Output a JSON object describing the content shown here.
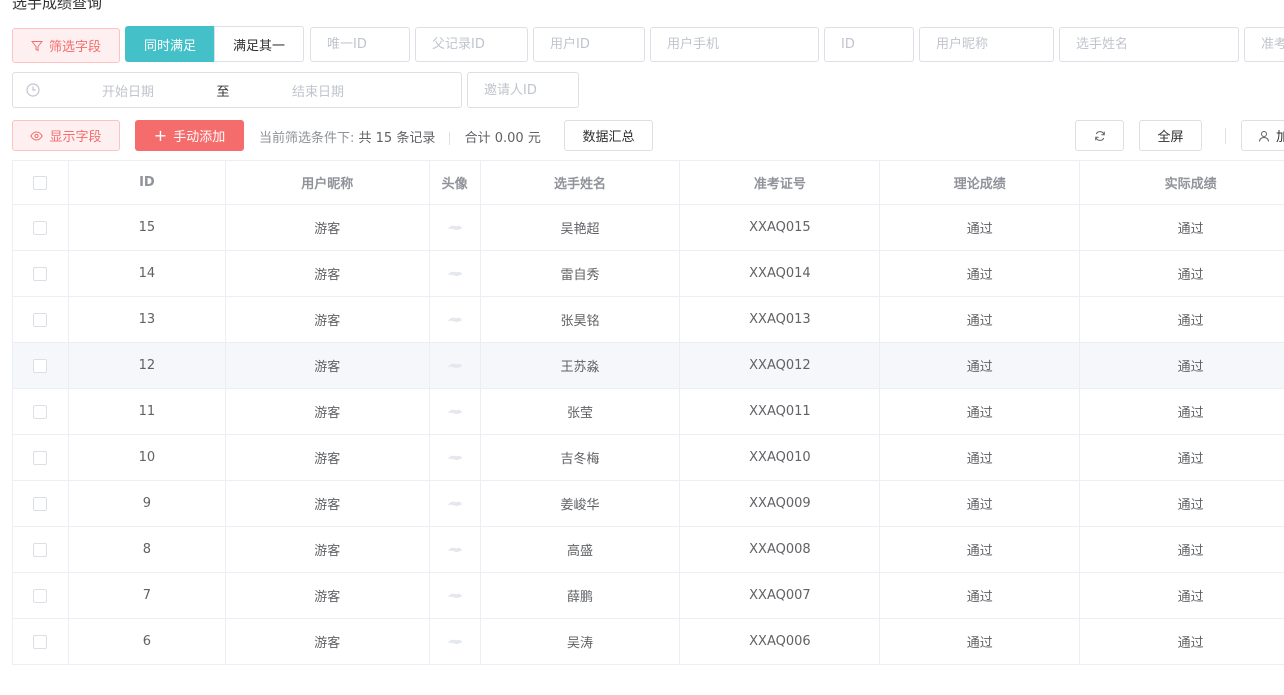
{
  "page": {
    "title": "选手成绩查询"
  },
  "filters": {
    "filter_button": "筛选字段",
    "match_all": "同时满足",
    "match_any": "满足其一",
    "placeholders": {
      "unique_id": "唯一ID",
      "parent_id": "父记录ID",
      "user_id": "用户ID",
      "user_phone": "用户手机",
      "id": "ID",
      "user_nickname": "用户昵称",
      "player_name": "选手姓名",
      "exam_no": "准考"
    },
    "date_range": {
      "start": "开始日期",
      "separator": "至",
      "end": "结束日期"
    },
    "inviter_placeholder": "邀请人ID"
  },
  "toolbar": {
    "show_fields": "显示字段",
    "manual_add": "手动添加",
    "summary_prefix": "当前筛选条件下:",
    "summary_count": "共 15 条记录",
    "summary_total": "合计 0.00 元",
    "aggregate": "数据汇总",
    "fullscreen": "全屏",
    "user_button": "加"
  },
  "table": {
    "columns": [
      "ID",
      "用户昵称",
      "头像",
      "选手姓名",
      "准考证号",
      "理论成绩",
      "实际成绩"
    ],
    "rows": [
      {
        "id": "15",
        "nickname": "游客",
        "name": "吴艳超",
        "exam_no": "XXAQ015",
        "theory": "通过",
        "practical": "通过"
      },
      {
        "id": "14",
        "nickname": "游客",
        "name": "雷自秀",
        "exam_no": "XXAQ014",
        "theory": "通过",
        "practical": "通过"
      },
      {
        "id": "13",
        "nickname": "游客",
        "name": "张昊铭",
        "exam_no": "XXAQ013",
        "theory": "通过",
        "practical": "通过"
      },
      {
        "id": "12",
        "nickname": "游客",
        "name": "王苏淼",
        "exam_no": "XXAQ012",
        "theory": "通过",
        "practical": "通过"
      },
      {
        "id": "11",
        "nickname": "游客",
        "name": "张莹",
        "exam_no": "XXAQ011",
        "theory": "通过",
        "practical": "通过"
      },
      {
        "id": "10",
        "nickname": "游客",
        "name": "吉冬梅",
        "exam_no": "XXAQ010",
        "theory": "通过",
        "practical": "通过"
      },
      {
        "id": "9",
        "nickname": "游客",
        "name": "姜峻华",
        "exam_no": "XXAQ009",
        "theory": "通过",
        "practical": "通过"
      },
      {
        "id": "8",
        "nickname": "游客",
        "name": "高盛",
        "exam_no": "XXAQ008",
        "theory": "通过",
        "practical": "通过"
      },
      {
        "id": "7",
        "nickname": "游客",
        "name": "薛鹏",
        "exam_no": "XXAQ007",
        "theory": "通过",
        "practical": "通过"
      },
      {
        "id": "6",
        "nickname": "游客",
        "name": "吴涛",
        "exam_no": "XXAQ006",
        "theory": "通过",
        "practical": "通过"
      }
    ],
    "highlighted_row": 3
  },
  "colors": {
    "primary": "#43c0c8",
    "danger": "#f56c6c",
    "danger_light": "#fef0f0"
  }
}
